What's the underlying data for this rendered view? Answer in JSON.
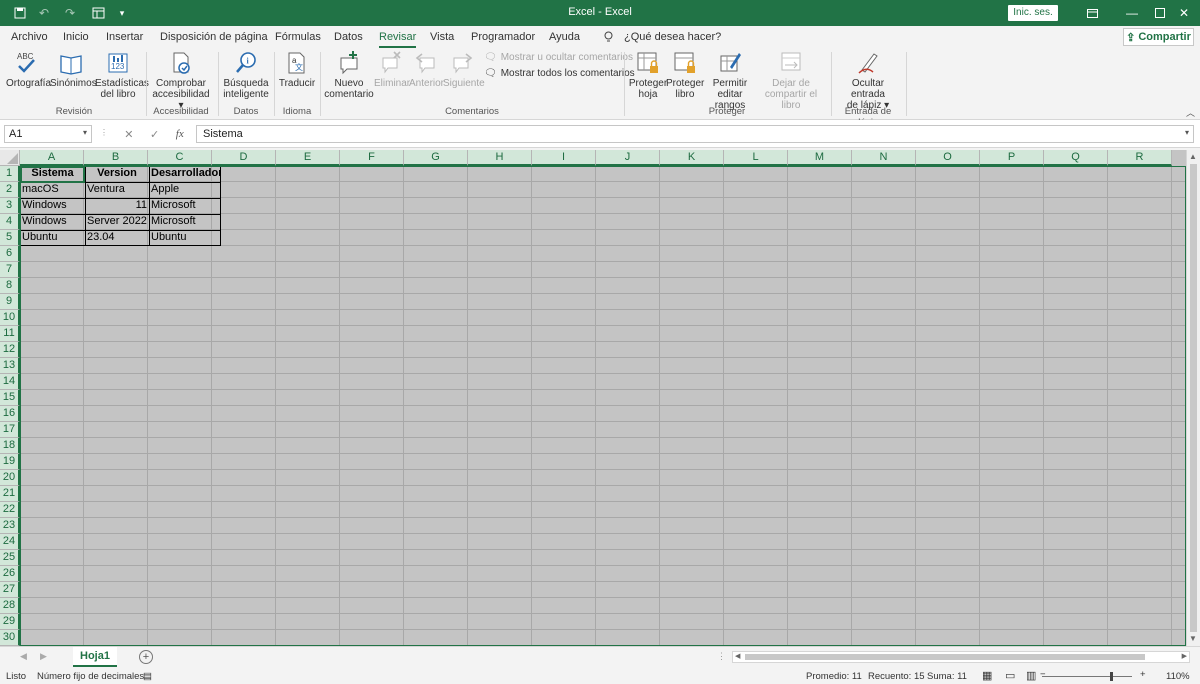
{
  "app": {
    "title": "Excel  -  Excel",
    "signin_label": "Inic. ses.",
    "share_label": "Compartir",
    "brand_color": "#217346"
  },
  "tabs": [
    "Archivo",
    "Inicio",
    "Insertar",
    "Disposición de página",
    "Fórmulas",
    "Datos",
    "Revisar",
    "Vista",
    "Programador",
    "Ayuda"
  ],
  "active_tab": "Revisar",
  "tell_me": "¿Qué desea hacer?",
  "ribbon": {
    "buttons": {
      "ortografia": "Ortografía",
      "sinonimos": "Sinónimos",
      "estadisticas_1": "Estadísticas",
      "estadisticas_2": "del libro",
      "comprobar_1": "Comprobar",
      "comprobar_2": "accesibilidad",
      "busqueda_1": "Búsqueda",
      "busqueda_2": "inteligente",
      "traducir": "Traducir",
      "nuevo_1": "Nuevo",
      "nuevo_2": "comentario",
      "eliminar": "Eliminar",
      "anterior": "Anterior",
      "siguiente": "Siguiente",
      "mostrar_ocultar": "Mostrar u ocultar comentarios",
      "mostrar_todos": "Mostrar todos los comentarios",
      "proteger_hoja_1": "Proteger",
      "proteger_hoja_2": "hoja",
      "proteger_libro_1": "Proteger",
      "proteger_libro_2": "libro",
      "permitir_1": "Permitir",
      "permitir_2": "editar rangos",
      "dejar_1": "Dejar de",
      "dejar_2": "compartir el libro",
      "ocultar_1": "Ocultar entrada",
      "ocultar_2": "de lápiz"
    },
    "groups": {
      "revision": "Revisión",
      "accesibilidad": "Accesibilidad",
      "datos": "Datos",
      "idioma": "Idioma",
      "comentarios": "Comentarios",
      "proteger": "Proteger",
      "lapiz": "Entrada de lápiz"
    }
  },
  "formula_bar": {
    "name_box": "A1",
    "formula": "Sistema",
    "fx_label": "fx"
  },
  "columns": [
    "A",
    "B",
    "C",
    "D",
    "E",
    "F",
    "G",
    "H",
    "I",
    "J",
    "K",
    "L",
    "M",
    "N",
    "O",
    "P",
    "Q",
    "R"
  ],
  "rows": [
    "1",
    "2",
    "3",
    "4",
    "5",
    "6",
    "7",
    "8",
    "9",
    "10",
    "11",
    "12",
    "13",
    "14",
    "15",
    "16",
    "17",
    "18",
    "19",
    "20",
    "21",
    "22",
    "23",
    "24",
    "25",
    "26",
    "27",
    "28",
    "29",
    "30"
  ],
  "table": {
    "header": [
      "Sistema",
      "Version",
      "Desarrollador"
    ],
    "rows": [
      [
        "macOS",
        "Ventura",
        "Apple"
      ],
      [
        "Windows",
        "11",
        "Microsoft"
      ],
      [
        "Windows",
        "Server 2022",
        "Microsoft"
      ],
      [
        "Ubuntu",
        "23.04",
        "Ubuntu"
      ]
    ]
  },
  "sheet": {
    "name": "Hoja1"
  },
  "status": {
    "mode": "Listo",
    "fixed_decimal": "Número fijo de decimales",
    "average": "Promedio: 11",
    "count": "Recuento: 15",
    "sum": "Suma: 11",
    "zoom": "110%"
  }
}
